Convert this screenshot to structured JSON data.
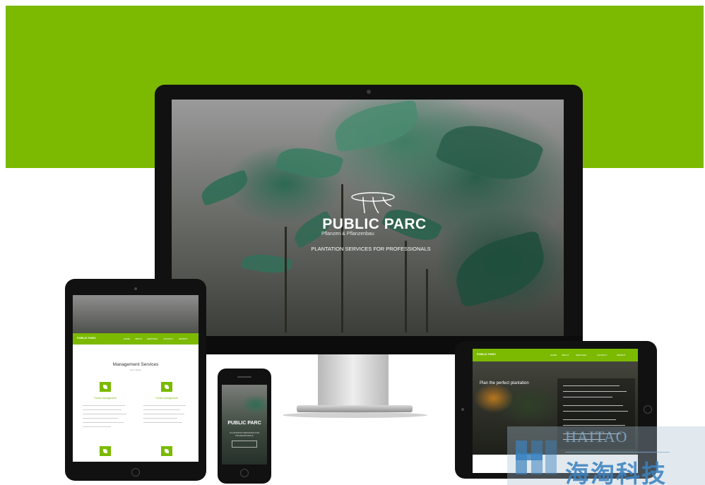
{
  "colors": {
    "accent_green": "#7bba00",
    "device_black": "#111111",
    "watermark_blue": "#3c82be"
  },
  "imac": {
    "logo_icon": "public-parc-logo-icon",
    "title": "PUBLIC PARC",
    "subtitle": "Pflanzen & Pflanzenbau",
    "tagline": "PLANTATION SERVICES FOR PROFESSIONALS"
  },
  "tablet_left": {
    "nav_logo": "PUBLIC PARC",
    "nav_items": [
      "HOME",
      "ABOUT",
      "SERVICES",
      "CONTACT",
      "IMPRINT"
    ],
    "heading": "Management Services",
    "heading_sub": "lorem ipsum",
    "col_titles": [
      "Forest management",
      "Forest management"
    ],
    "icon": "leaf-icon"
  },
  "phone": {
    "title": "PUBLIC PARC",
    "subtitle": "PLANTATION SERVICES FOR PROFESSIONALS"
  },
  "tablet_right": {
    "nav_logo": "PUBLIC PARC",
    "nav_items": [
      "HOME",
      "ABOUT",
      "SERVICES",
      "CONTACT",
      "IMPRINT"
    ],
    "hero_title": "Plan the perfect plantation"
  },
  "watermark": {
    "top_text": "HAITAO",
    "chinese_text": "海淘科技",
    "logo_icon": "haitao-logo-icon"
  }
}
